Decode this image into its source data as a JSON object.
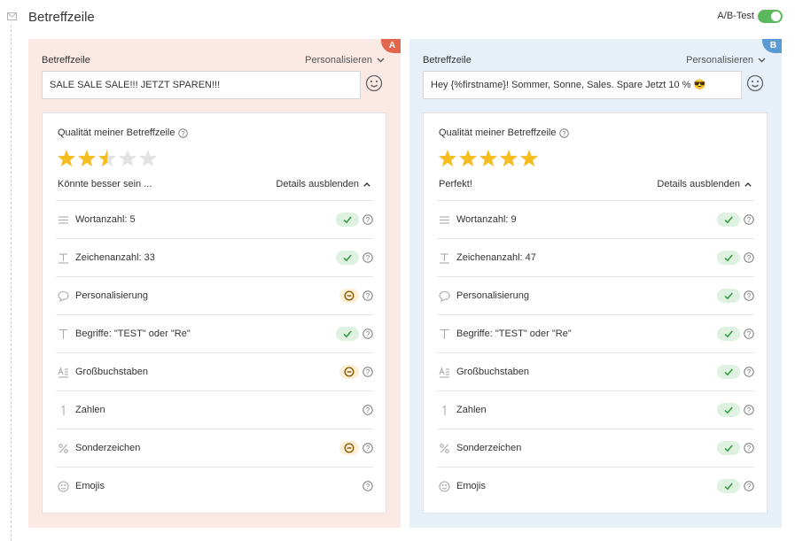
{
  "header": {
    "title": "Betreffzeile",
    "ab_label": "A/B-Test",
    "ab_enabled": true
  },
  "colors": {
    "panel_a_bg": "#fbe9e6",
    "panel_b_bg": "#e7f0f9",
    "badge_a": "#e2664d",
    "badge_b": "#5b9bd5",
    "ok": "#3c9d48",
    "warn": "#8a5a00",
    "star": "#f5bd1f",
    "star_empty": "#e3e3e3"
  },
  "panels": [
    {
      "badge": "A",
      "field_label": "Betreffzeile",
      "personalize_label": "Personalisieren",
      "subject": "SALE SALE SALE!!! JETZT SPAREN!!!",
      "quality_title": "Qualität meiner Betreffzeile",
      "rating": 2.5,
      "rating_max": 5,
      "verdict": "Könnte besser sein ...",
      "details_label": "Details ausblenden",
      "criteria": [
        {
          "icon": "lines-icon",
          "label": "Wortanzahl: 5",
          "status": "ok"
        },
        {
          "icon": "text-size-icon",
          "label": "Zeichenanzahl: 33",
          "status": "ok"
        },
        {
          "icon": "speech-bubble-icon",
          "label": "Personalisierung",
          "status": "warn"
        },
        {
          "icon": "letter-t-icon",
          "label": "Begriffe: \"TEST\" oder \"Re\"",
          "status": "ok"
        },
        {
          "icon": "uppercase-icon",
          "label": "Großbuchstaben",
          "status": "warn"
        },
        {
          "icon": "number-one-icon",
          "label": "Zahlen",
          "status": "none"
        },
        {
          "icon": "percent-icon",
          "label": "Sonderzeichen",
          "status": "warn"
        },
        {
          "icon": "smiley-icon",
          "label": "Emojis",
          "status": "none"
        }
      ]
    },
    {
      "badge": "B",
      "field_label": "Betreffzeile",
      "personalize_label": "Personalisieren",
      "subject": "Hey {%firstname}! Sommer, Sonne, Sales. Spare Jetzt 10 % 😎",
      "quality_title": "Qualität meiner Betreffzeile",
      "rating": 5,
      "rating_max": 5,
      "verdict": "Perfekt!",
      "details_label": "Details ausblenden",
      "criteria": [
        {
          "icon": "lines-icon",
          "label": "Wortanzahl: 9",
          "status": "ok"
        },
        {
          "icon": "text-size-icon",
          "label": "Zeichenanzahl: 47",
          "status": "ok"
        },
        {
          "icon": "speech-bubble-icon",
          "label": "Personalisierung",
          "status": "ok"
        },
        {
          "icon": "letter-t-icon",
          "label": "Begriffe: \"TEST\" oder \"Re\"",
          "status": "ok"
        },
        {
          "icon": "uppercase-icon",
          "label": "Großbuchstaben",
          "status": "ok"
        },
        {
          "icon": "number-one-icon",
          "label": "Zahlen",
          "status": "ok"
        },
        {
          "icon": "percent-icon",
          "label": "Sonderzeichen",
          "status": "ok"
        },
        {
          "icon": "smiley-icon",
          "label": "Emojis",
          "status": "ok"
        }
      ]
    }
  ]
}
